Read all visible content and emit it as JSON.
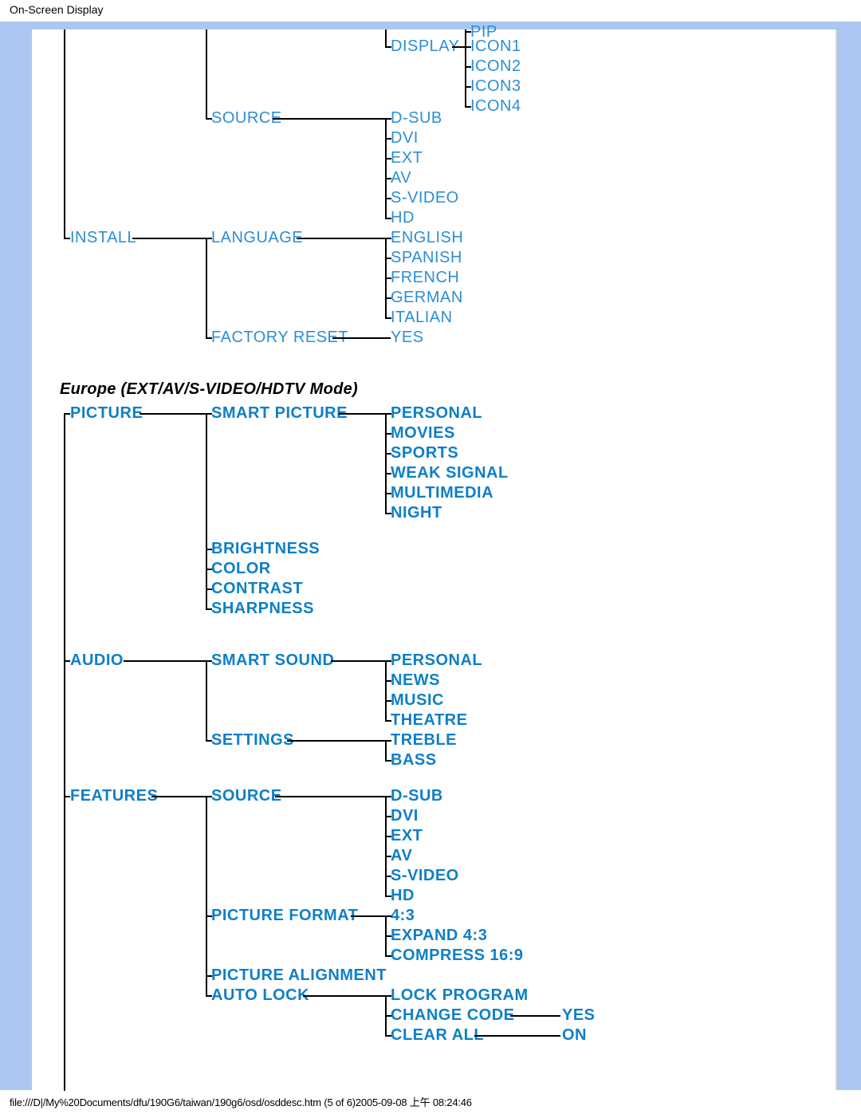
{
  "page": {
    "header": "On-Screen Display",
    "footer": "file:///D|/My%20Documents/dfu/190G6/taiwan/190g6/osd/osddesc.htm (5 of 6)2005-09-08 上午 08:24:46",
    "section2_title": "Europe (EXT/AV/S-VIDEO/HDTV Mode)"
  },
  "top": {
    "pip": "PIP",
    "display": "DISPLAY",
    "icon1": "ICON1",
    "icon2": "ICON2",
    "icon3": "ICON3",
    "icon4": "ICON4",
    "source": "SOURCE",
    "dsub": "D-SUB",
    "dvi": "DVI",
    "ext": "EXT",
    "av": "AV",
    "svideo": "S-VIDEO",
    "hd": "HD",
    "install": "INSTALL",
    "language": "LANGUAGE",
    "english": "ENGLISH",
    "spanish": "SPANISH",
    "french": "FRENCH",
    "german": "GERMAN",
    "italian": "ITALIAN",
    "factory_reset": "FACTORY RESET",
    "yes": "YES"
  },
  "eu": {
    "picture": "PICTURE",
    "smart_picture": "SMART PICTURE",
    "personal": "PERSONAL",
    "movies": "MOVIES",
    "sports": "SPORTS",
    "weak_signal": "WEAK SIGNAL",
    "multimedia": "MULTIMEDIA",
    "night": "NIGHT",
    "brightness": "BRIGHTNESS",
    "color": "COLOR",
    "contrast": "CONTRAST",
    "sharpness": "SHARPNESS",
    "audio": "AUDIO",
    "smart_sound": "SMART SOUND",
    "personal2": "PERSONAL",
    "news": "NEWS",
    "music": "MUSIC",
    "theatre": "THEATRE",
    "settings": "SETTINGS",
    "treble": "TREBLE",
    "bass": "BASS",
    "features": "FEATURES",
    "source": "SOURCE",
    "dsub": "D-SUB",
    "dvi": "DVI",
    "ext": "EXT",
    "av": "AV",
    "svideo": "S-VIDEO",
    "hd": "HD",
    "picture_format": "PICTURE FORMAT",
    "r43": "4:3",
    "r43e": "EXPAND 4:3",
    "r169c": "COMPRESS 16:9",
    "picture_alignment": "PICTURE ALIGNMENT",
    "auto_lock": "AUTO LOCK",
    "lock_program": "LOCK PROGRAM",
    "change_code": "CHANGE CODE",
    "clear_all": "CLEAR ALL",
    "yes": "YES",
    "on": "ON"
  },
  "chart_data": [
    {
      "type": "tree",
      "title": "OSD menu (continued from previous page)",
      "nodes": {
        "(root-continued)": {
          "(features-continued)": {
            "(pip-continued)": {
              "DISPLAY": [
                "ICON1",
                "ICON2",
                "ICON3",
                "ICON4"
              ]
            },
            "SOURCE": [
              "D-SUB",
              "DVI",
              "EXT",
              "AV",
              "S-VIDEO",
              "HD"
            ]
          },
          "INSTALL": {
            "LANGUAGE": [
              "ENGLISH",
              "SPANISH",
              "FRENCH",
              "GERMAN",
              "ITALIAN"
            ],
            "FACTORY RESET": [
              "YES"
            ]
          }
        }
      }
    },
    {
      "type": "tree",
      "title": "Europe (EXT/AV/S-VIDEO/HDTV Mode)",
      "nodes": {
        "PICTURE": {
          "SMART PICTURE": [
            "PERSONAL",
            "MOVIES",
            "SPORTS",
            "WEAK SIGNAL",
            "MULTIMEDIA",
            "NIGHT"
          ],
          "BRIGHTNESS": [],
          "COLOR": [],
          "CONTRAST": [],
          "SHARPNESS": []
        },
        "AUDIO": {
          "SMART SOUND": [
            "PERSONAL",
            "NEWS",
            "MUSIC",
            "THEATRE"
          ],
          "SETTINGS": [
            "TREBLE",
            "BASS"
          ]
        },
        "FEATURES": {
          "SOURCE": [
            "D-SUB",
            "DVI",
            "EXT",
            "AV",
            "S-VIDEO",
            "HD"
          ],
          "PICTURE FORMAT": [
            "4:3",
            "EXPAND 4:3",
            "COMPRESS 16:9"
          ],
          "PICTURE ALIGNMENT": [],
          "AUTO LOCK": {
            "LOCK PROGRAM": [],
            "CHANGE CODE": [
              "YES"
            ],
            "CLEAR ALL": [
              "ON"
            ]
          }
        }
      }
    }
  ]
}
